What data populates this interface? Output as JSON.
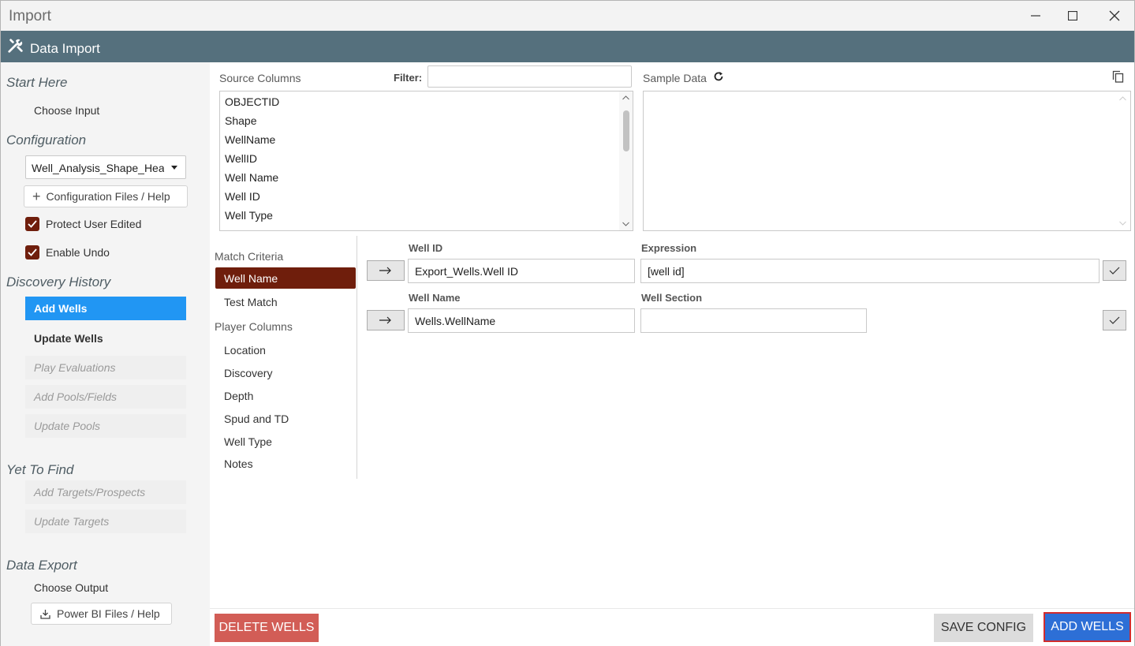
{
  "window": {
    "title": "Import"
  },
  "header": {
    "title": "Data Import",
    "icon": "tools-icon"
  },
  "sidebar": {
    "start_here": "Start Here",
    "choose_input": "Choose Input",
    "configuration": "Configuration",
    "config_select_value": "Well_Analysis_Shape_Header",
    "config_files_button": "Configuration Files / Help",
    "protect_user_edited": "Protect User Edited",
    "enable_undo": "Enable Undo",
    "discovery_history": "Discovery History",
    "discovery_items": [
      "Add Wells",
      "Update Wells",
      "Play Evaluations",
      "Add Pools/Fields",
      "Update Pools"
    ],
    "yet_to_find": "Yet To Find",
    "ytf_items": [
      "Add Targets/Prospects",
      "Update Targets"
    ],
    "data_export": "Data Export",
    "choose_output": "Choose Output",
    "power_bi_button": "Power BI Files / Help"
  },
  "main": {
    "source_columns_label": "Source Columns",
    "filter_label": "Filter:",
    "filter_value": "",
    "sample_data_label": "Sample Data",
    "source_columns": [
      "OBJECTID",
      "Shape",
      "WellName",
      "WellID",
      "Well Name",
      "Well ID",
      "Well Type"
    ],
    "match_criteria": "Match Criteria",
    "match_items": [
      "Well Name",
      "Test Match"
    ],
    "player_columns": "Player Columns",
    "player_items": [
      "Location",
      "Discovery",
      "Depth",
      "Spud and TD",
      "Well Type",
      "Notes"
    ],
    "well_id_label": "Well ID",
    "well_id_value": "Export_Wells.Well ID",
    "expression_label": "Expression",
    "expression_value": "[well id]",
    "well_name_label": "Well Name",
    "well_name_value": "Wells.WellName",
    "well_section_label": "Well Section",
    "well_section_value": ""
  },
  "footer": {
    "delete_button": "DELETE WELLS",
    "save_button": "SAVE CONFIG",
    "add_button": "ADD WELLS"
  },
  "colors": {
    "header_bg": "#55707d",
    "accent_blue": "#2196f3",
    "accent_maroon": "#6f1e0c",
    "delete_red": "#d25d56",
    "add_blue": "#2d6fd6"
  }
}
